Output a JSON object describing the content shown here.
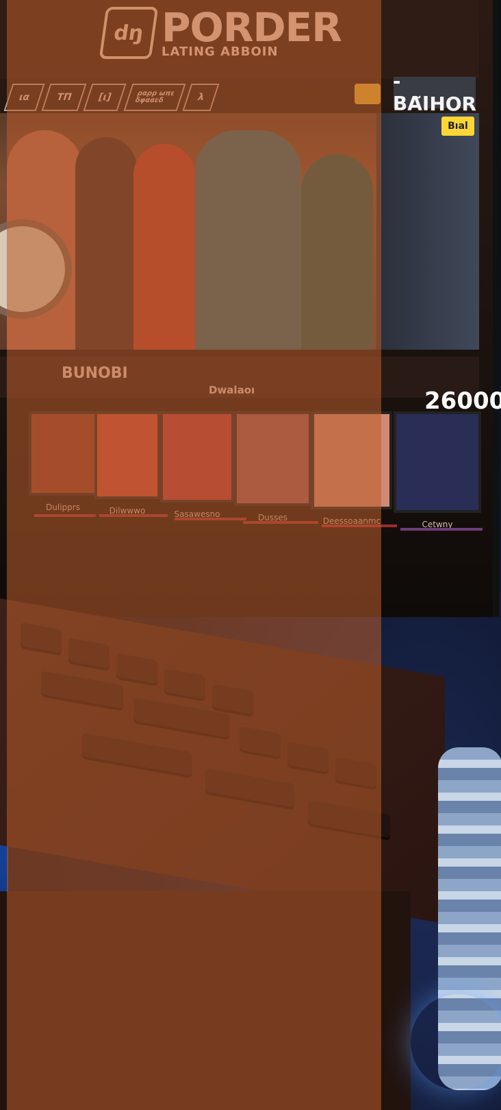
{
  "header": {
    "logo_mark": "dŋ",
    "logo_text": "PORDER",
    "logo_subtitle": "LATING ABBOIN",
    "nav": [
      "ια",
      "ΤΠ",
      "[ι]",
      "ραρρ ωπε\nδφααεδ",
      "λ"
    ],
    "author": "- ΒΑ̃ΙHOR"
  },
  "hero": {
    "tag": "Bıal"
  },
  "tabs": {
    "left": "BUNOBI",
    "middle": "Dwalaoı",
    "score": "26000."
  },
  "cards": [
    {
      "label": "Dulipprs"
    },
    {
      "label": "Dilwwwo"
    },
    {
      "label": "Sasawesno"
    },
    {
      "label": "Dusses"
    },
    {
      "label": "Deessoaanmc"
    },
    {
      "label": "Cetwny"
    }
  ],
  "colors": {
    "overlay": "#b95c2d",
    "accent_yellow": "#ffd634",
    "score_white": "#ffffff"
  }
}
